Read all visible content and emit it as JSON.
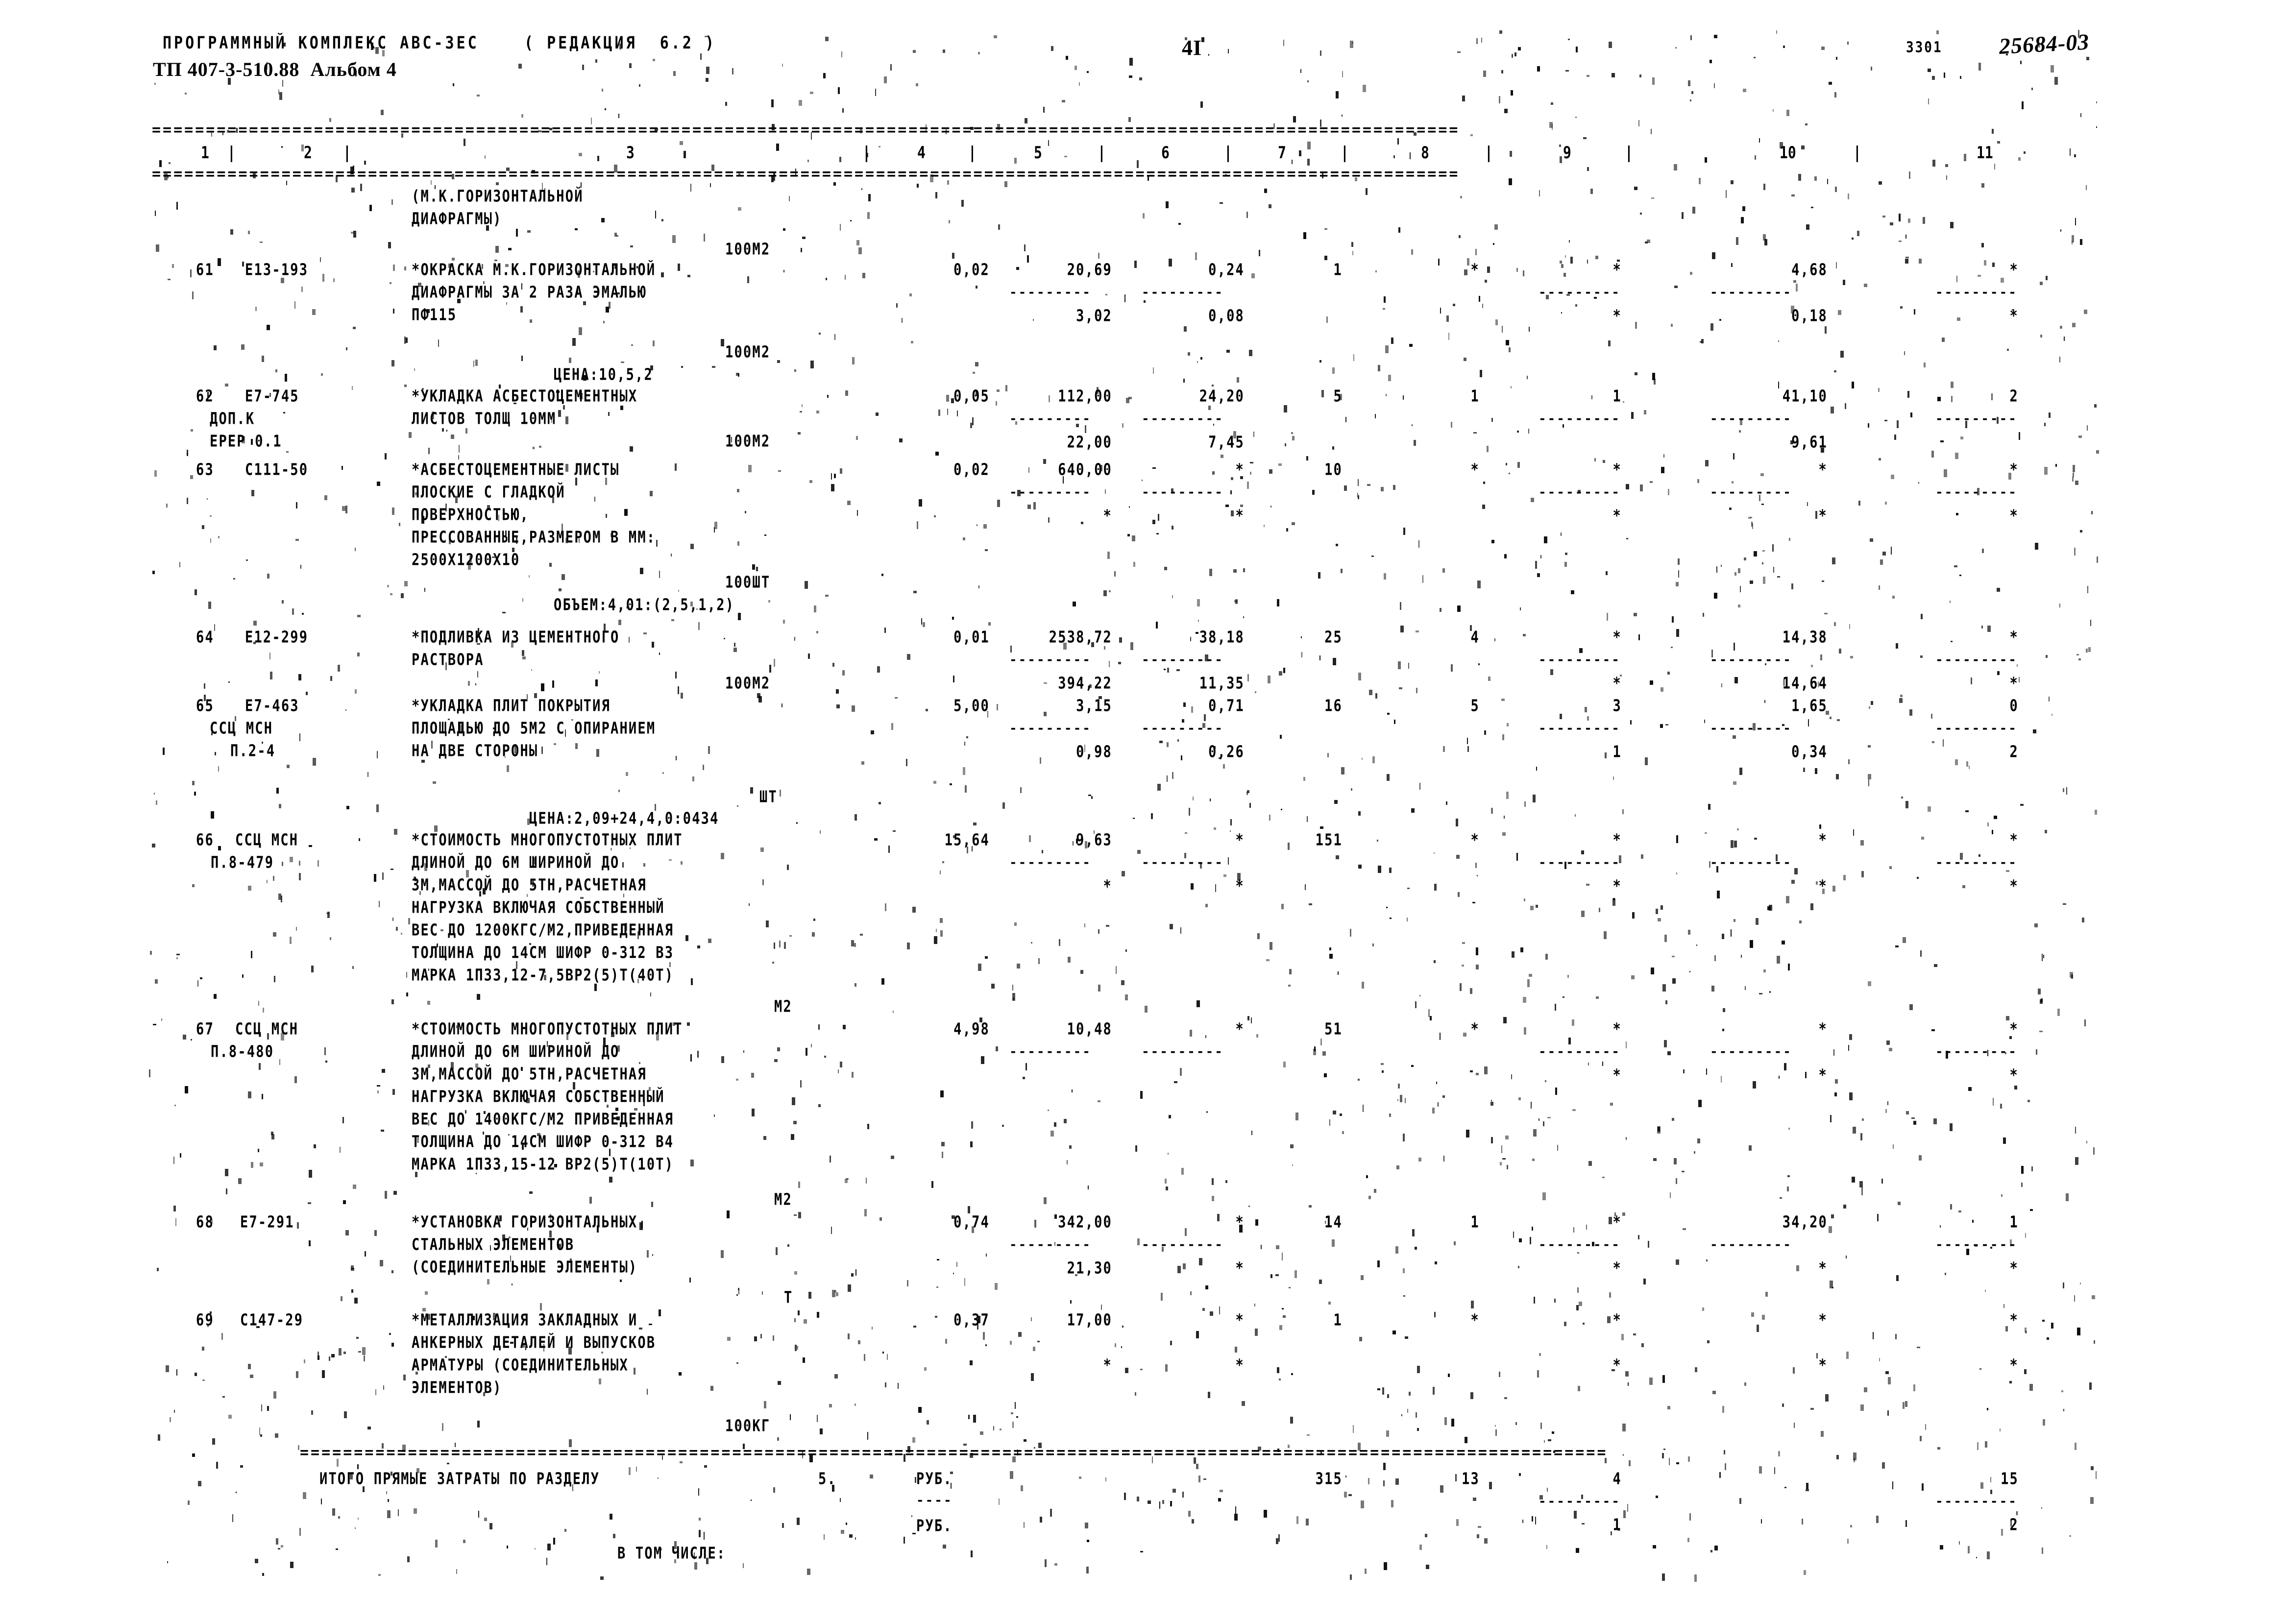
{
  "header": {
    "program_line": "ПРОГРАММНЫЙ КОМПЛЕКС АВС-ЗЕС    ( РЕДАКЦИЯ  6.2 )",
    "project_line": "ТП 407-3-510.88  Альбом 4",
    "page_number": "4I",
    "stamp_number": "3301",
    "handwritten_number": "25684-03"
  },
  "table": {
    "column_headers": [
      "1",
      "2",
      "3",
      "4",
      "5",
      "6",
      "7",
      "8",
      "9",
      "10",
      "11"
    ],
    "separator": "=========================================================================================================================",
    "dash_unit": "---------",
    "rows": [
      {
        "no": "",
        "code": "",
        "code2": "",
        "code3": "",
        "desc": [
          "(М.К.ГОРИЗОНТАЛЬНОЙ",
          "ДИАФРАГМЫ)"
        ],
        "unit": "",
        "unit_pos": ""
      },
      {
        "no": "61",
        "code": "Е13-193",
        "code2": "",
        "code3": "",
        "unit": "100М2",
        "desc": [
          "*ОКРАСКА М.К.ГОРИЗОНТАЛЬНОЙ",
          "ДИАФРАГМЫ ЗА 2 РАЗА ЭМАЛЬЮ",
          "ПФ115"
        ],
        "v4": "0,02",
        "v5": "20,69",
        "v6": "0,24",
        "v7": "1",
        "v8": "*",
        "v9": "*",
        "v10": "4,68",
        "v11": "*",
        "s5": "3,02",
        "s6": "0,08",
        "s9": "*",
        "s10": "0,18",
        "s11": "*"
      },
      {
        "no": "62",
        "code": "Е7-745",
        "code2": "ДОП.К",
        "code3": "ЕРЕР 0.1",
        "unit": "100М2",
        "note": "ЦЕНА:10,5,2",
        "desc": [
          "*УКЛАДКА АСБЕСТОЦЕМЕНТНЫХ",
          "ЛИСТОВ ТОЛЩ 10ММ"
        ],
        "v4": "0,05",
        "v5": "112,00",
        "v6": "24,20",
        "v7": "5",
        "v8": "1",
        "v9": "1",
        "v10": "41,10",
        "v11": "2",
        "s5": "22,00",
        "s6": "7,45",
        "s10": "9,61"
      },
      {
        "no": "63",
        "code": "С111-50",
        "code2": "",
        "code3": "",
        "unit": "100М2",
        "desc": [
          "*АСБЕСТОЦЕМЕНТНЫЕ ЛИСТЫ",
          "ПЛОСКИЕ С ГЛАДКОЙ",
          "ПОВЕРХНОСТЬЮ,",
          "ПРЕССОВАННЫЕ,РАЗМЕРОМ В ММ:",
          "2500X1200X10"
        ],
        "v4": "0,02",
        "v5": "640,00",
        "v6": "*",
        "v7": "10",
        "v8": "*",
        "v9": "*",
        "v10": "*",
        "v11": "*"
      },
      {
        "no": "64",
        "code": "Е12-299",
        "code2": "",
        "code3": "",
        "unit": "100ШТ",
        "note": "ОБЪЕМ:4,01:(2,5,1,2)",
        "desc": [
          "*ПОДЛИВКА ИЗ ЦЕМЕНТНОГО",
          "РАСТВОРА"
        ],
        "v4": "0,01",
        "v5": "2538,72",
        "v6": "38,18",
        "v7": "25",
        "v8": "4",
        "v9": "*",
        "v10": "14,38",
        "v11": "*",
        "s5": "394,22",
        "s6": "11,35",
        "s10": "14,64",
        "s11": "*"
      },
      {
        "no": "65",
        "code": "Е7-463",
        "code2": "ССЦ МСН",
        "code3": "П.2-4",
        "unit": "100М2",
        "desc": [
          "*УКЛАДКА ПЛИТ ПОКРЫТИЯ",
          "ПЛОЩАДЬЮ ДО 5М2 С ОПИРАНИЕМ",
          "НА ДВЕ СТОРОНЫ"
        ],
        "v4": "5,00",
        "v5": "3,15",
        "v6": "0,71",
        "v7": "16",
        "v8": "5",
        "v9": "3",
        "v10": "1,65",
        "v11": "0",
        "s5": "0,98",
        "s6": "0,26",
        "s9": "1",
        "s10": "0,34",
        "s11": "2"
      },
      {
        "no": "66",
        "code": "ССЦ МСН",
        "code2": "П.8-479",
        "code3": "",
        "unit": "ШТ",
        "note": "ЦЕНА:2,09+24,4,0:0434",
        "desc": [
          "*СТОИМОСТЬ МНОГОПУСТОТНЫХ ПЛИТ",
          "ДЛИНОЙ ДО 6М ШИРИНОЙ ДО",
          "3М,МАССОЙ ДО 5ТН,РАСЧЕТНАЯ",
          "НАГРУЗКА ВКЛЮЧАЯ СОБСТВЕННЫЙ",
          "ВЕС ДО 1200КГС/М2,ПРИВЕДЕННАЯ",
          "ТОЛЩИНА ДО 14СМ ШИФР 0-312 ВЗ",
          "МАРКА 1П33,12-7,5ВР2(5)Т(40Т)"
        ],
        "v4": "15,64",
        "v5": "9,63",
        "v6": "*",
        "v7": "151",
        "v8": "*",
        "v9": "*",
        "v10": "*",
        "v11": "*"
      },
      {
        "no": "67",
        "code": "ССЦ МСН",
        "code2": "П.8-480",
        "code3": "",
        "unit": "М2",
        "desc": [
          "*СТОИМОСТЬ МНОГОПУСТОТНЫХ ПЛИТ",
          "ДЛИНОЙ ДО 6М ШИРИНОЙ ДО",
          "3М,МАССОЙ ДО 5ТН,РАСЧЕТНАЯ",
          "НАГРУЗКА ВКЛЮЧАЯ СОБСТВЕННЫЙ",
          "ВЕС ДО 1400КГС/М2 ПРИВЕДЕННАЯ",
          "ТОЛЩИНА ДО 14СМ ШИФР 0-312 В4",
          "МАРКА 1П33,15-12 ВР2(5)Т(10Т)"
        ],
        "v4": "4,98",
        "v5": "10,48",
        "v6": "*",
        "v7": "51",
        "v8": "*",
        "v9": "*",
        "v10": "*",
        "v11": "*"
      },
      {
        "no": "68",
        "code": "Е7-291",
        "code2": "",
        "code3": "",
        "unit": "М2",
        "desc": [
          "*УСТАНОВКА ГОРИЗОНТАЛЬНЫХ",
          "СТАЛЬНЫХ ЭЛЕМЕНТОВ",
          "(СОЕДИНИТЕЛЬНЫЕ ЭЛЕМЕНТЫ)"
        ],
        "v4": "0,74",
        "v5": "342,00",
        "v6": "*",
        "v7": "14",
        "v8": "1",
        "v9": "*",
        "v10": "34,20",
        "v11": "1",
        "s5": "21,30",
        "s6": "*"
      },
      {
        "no": "69",
        "code": "С147-29",
        "code2": "",
        "code3": "",
        "unit": "Т",
        "unit2": "100КГ",
        "desc": [
          "*МЕТАЛЛИЗАЦИЯ ЗАКЛАДНЫХ И",
          "АНКЕРНЫХ ДЕТАЛЕЙ И ВЫПУСКОВ",
          "АРМАТУРЫ (СОЕДИНИТЕЛЬНЫХ",
          "ЭЛЕМЕНТОВ)"
        ],
        "v4": "0,37",
        "v5": "17,00",
        "v6": "*",
        "v7": "1",
        "v8": "*",
        "v9": "*",
        "v10": "*",
        "v11": "*"
      }
    ],
    "totals": {
      "label": "ИТОГО ПРЯМЫЕ ЗАТРАТЫ ПО РАЗДЕЛУ",
      "section": "5.",
      "currency": "РУБ.",
      "currency2": "РУБ.",
      "subtotal_label": "В ТОМ ЧИСЛЕ:",
      "t7": "315",
      "t8": "13",
      "t9": "4",
      "t11": "15",
      "u9": "1",
      "u11": "2"
    }
  }
}
